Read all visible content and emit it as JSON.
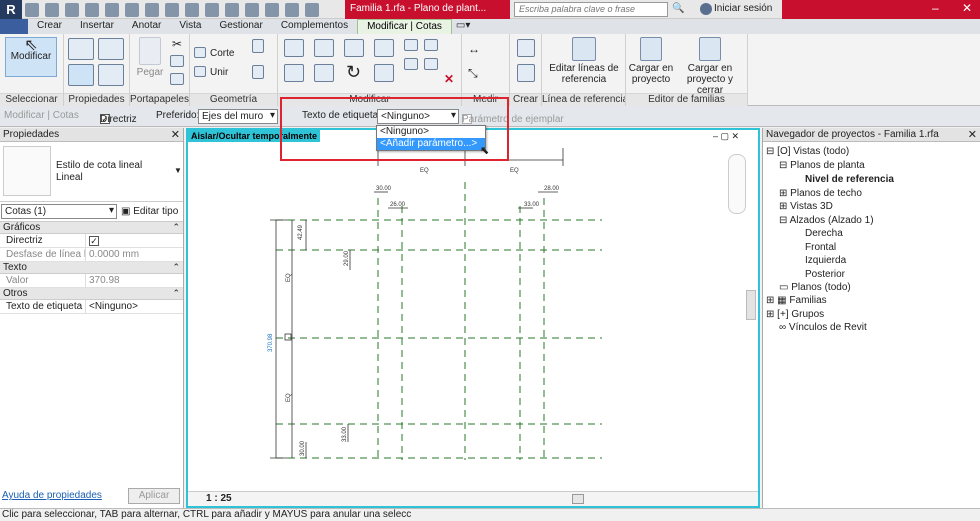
{
  "titlebar": {
    "logo": "R",
    "doc_title": "Familia 1.rfa - Plano de plant...",
    "search_placeholder": "Escriba palabra clave o frase",
    "signin": "Iniciar sesión"
  },
  "tabs": [
    "Crear",
    "Insertar",
    "Anotar",
    "Vista",
    "Gestionar",
    "Complementos",
    "Modificar | Cotas"
  ],
  "ribbon": {
    "modificar": "Modificar",
    "pegar": "Pegar",
    "corte": "Corte",
    "unir": "Unir",
    "editar_lineas": "Editar líneas de referencia",
    "cargar_proyecto": "Cargar en proyecto",
    "cargar_cerrar": "Cargar en proyecto y cerrar",
    "groups": [
      "Seleccionar",
      "Propiedades",
      "Portapapeles",
      "Geometría",
      "Modificar",
      "Medir",
      "Crear",
      "Línea de referencia",
      "Editor de familias"
    ]
  },
  "optbar": {
    "context": "Modificar | Cotas",
    "directriz": "Directriz",
    "preferido_label": "Preferido:",
    "preferido_value": "Ejes del muro",
    "etiqueta_label": "Texto de etiqueta:",
    "etiqueta_value": "<Ninguno>",
    "ejemplar": "Parámetro de ejemplar"
  },
  "dropdown": {
    "opt1": "<Ninguno>",
    "opt2": "<Añadir parámetro...>"
  },
  "props": {
    "title": "Propiedades",
    "type_name": "Estilo de cota lineal",
    "type_sub": "Lineal",
    "selector": "Cotas (1)",
    "edit_type": "Editar tipo",
    "sec_graficos": "Gráficos",
    "directriz": "Directriz",
    "desfase": "Desfase de línea b...",
    "desfase_val": "0.0000 mm",
    "sec_texto": "Texto",
    "valor": "Valor",
    "valor_val": "370.98",
    "sec_otros": "Otros",
    "texto_etiqueta": "Texto de etiqueta",
    "texto_etiqueta_val": "<Ninguno>",
    "help": "Ayuda de propiedades",
    "apply": "Aplicar"
  },
  "canvas": {
    "label": "Aislar/Ocultar temporalmente",
    "dims": {
      "eq1": "EQ",
      "eq2": "EQ",
      "d30": "30.00",
      "d26": "26.00",
      "d33a": "33.00",
      "d28": "28.00",
      "d42": "42.49",
      "d29": "29.00",
      "d33b": "33.00",
      "d30b": "30.00",
      "eqv1": "EQ",
      "eqv2": "EQ",
      "total": "370.98"
    },
    "scale": "1 : 25"
  },
  "nav": {
    "title": "Navegador de proyectos - Familia 1.rfa",
    "items": [
      "Vistas (todo)",
      "Planos de planta",
      "Nivel de referencia",
      "Planos de techo",
      "Vistas 3D",
      "Alzados (Alzado 1)",
      "Derecha",
      "Frontal",
      "Izquierda",
      "Posterior",
      "Planos (todo)",
      "Familias",
      "Grupos",
      "Vínculos de Revit"
    ]
  },
  "status": "Clic para seleccionar, TAB para alternar, CTRL para añadir y MAYÚS para anular una selecc",
  "colors": {
    "accent": "#2ec3d6",
    "red": "#c8102e",
    "select": "#3399ff",
    "grid": "#2a7a2a"
  }
}
